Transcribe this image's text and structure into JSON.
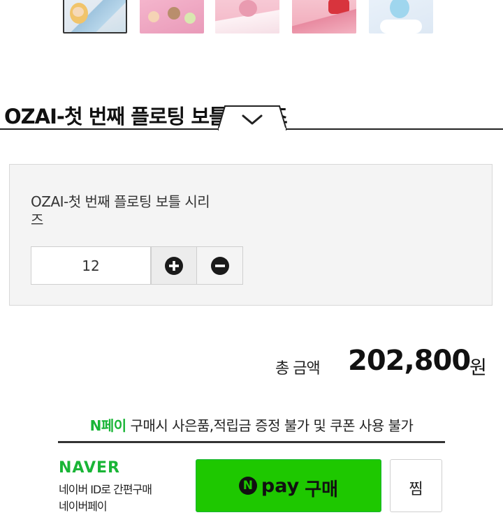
{
  "product": {
    "title": "OZAI-첫 번째 플로팅 보틀 시리즈",
    "option_name": "OZAI-첫 번째 플로팅 보틀 시리즈"
  },
  "quantity": {
    "value": "12"
  },
  "total": {
    "label": "총 금액",
    "amount": "202,800",
    "unit": "원"
  },
  "npay": {
    "notice_brand": "N페이",
    "notice_text": " 구매시 사은품,적립금 증정 불가 및 쿠폰 사용 불가",
    "naver_logo": "NAVER",
    "naver_desc_line1": "네이버 ID로 간편구매",
    "naver_desc_line2": "네이버페이",
    "n_mark": "N",
    "pay_label": "pay",
    "buy_label": "구매",
    "wish_label": "찜"
  },
  "icons": {
    "collapse": "chevron-down-icon",
    "plus": "plus-circle-icon",
    "minus": "minus-circle-icon"
  },
  "colors": {
    "npay_green": "#1ec800",
    "naver_green": "#19b536"
  }
}
